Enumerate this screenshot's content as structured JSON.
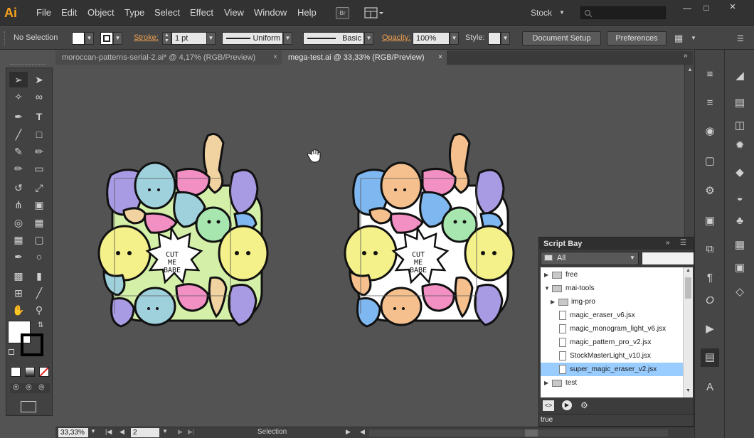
{
  "app": {
    "logo": "Ai"
  },
  "menu": [
    "File",
    "Edit",
    "Object",
    "Type",
    "Select",
    "Effect",
    "View",
    "Window",
    "Help"
  ],
  "menubar": {
    "bridge_label": "Br",
    "stock_label": "Stock",
    "search_placeholder": ""
  },
  "controlbar": {
    "selection": "No Selection",
    "stroke_label": "Stroke:",
    "stroke_value": "1 pt",
    "profile": "Uniform",
    "brush": "Basic",
    "opacity_label": "Opacity:",
    "opacity_value": "100%",
    "style_label": "Style:",
    "document_setup": "Document Setup",
    "preferences": "Preferences"
  },
  "tabs": [
    {
      "label": "moroccan-patterns-serial-2.ai* @ 4,17% (RGB/Preview)",
      "close": "×",
      "active": false
    },
    {
      "label": "mega-test.ai @ 33,33% (RGB/Preview)",
      "close": "×",
      "active": true
    }
  ],
  "artwork": {
    "sticker_text_lines": [
      "CUT",
      "ME",
      "BABE"
    ]
  },
  "statusbar": {
    "zoom": "33,33%",
    "page": "2",
    "mode": "Selection"
  },
  "scriptbay": {
    "title": "Script Bay",
    "filter": "All",
    "search_value": "",
    "items": [
      {
        "label": "free",
        "type": "folder",
        "level": 0,
        "expanded": false
      },
      {
        "label": "mai-tools",
        "type": "folder",
        "level": 0,
        "expanded": true
      },
      {
        "label": "img-pro",
        "type": "folder",
        "level": 1,
        "expanded": false
      },
      {
        "label": "magic_eraser_v6.jsx",
        "type": "file",
        "level": 1
      },
      {
        "label": "magic_monogram_light_v6.jsx",
        "type": "file",
        "level": 1
      },
      {
        "label": "magic_pattern_pro_v2.jsx",
        "type": "file",
        "level": 1
      },
      {
        "label": "StockMasterLight_v10.jsx",
        "type": "file",
        "level": 1
      },
      {
        "label": "super_magic_eraser_v2.jsx",
        "type": "file",
        "level": 1,
        "selected": true
      },
      {
        "label": "test",
        "type": "folder",
        "level": 0,
        "expanded": false
      }
    ],
    "result": "true"
  },
  "colors": {
    "accent_orange": "#f7a21b",
    "selection_blue": "#99ccff",
    "blob_yellow": "#f4f08a",
    "blob_purple": "#a99be3",
    "blob_pink": "#f28fc3",
    "blob_teal": "#9fd1dc",
    "blob_green": "#a8e6b0",
    "blob_peach": "#f5c08d",
    "blob_tan": "#f0d3a0",
    "blob_lightgreen": "#d4f0a8",
    "blob_blue": "#7fb8f0"
  }
}
